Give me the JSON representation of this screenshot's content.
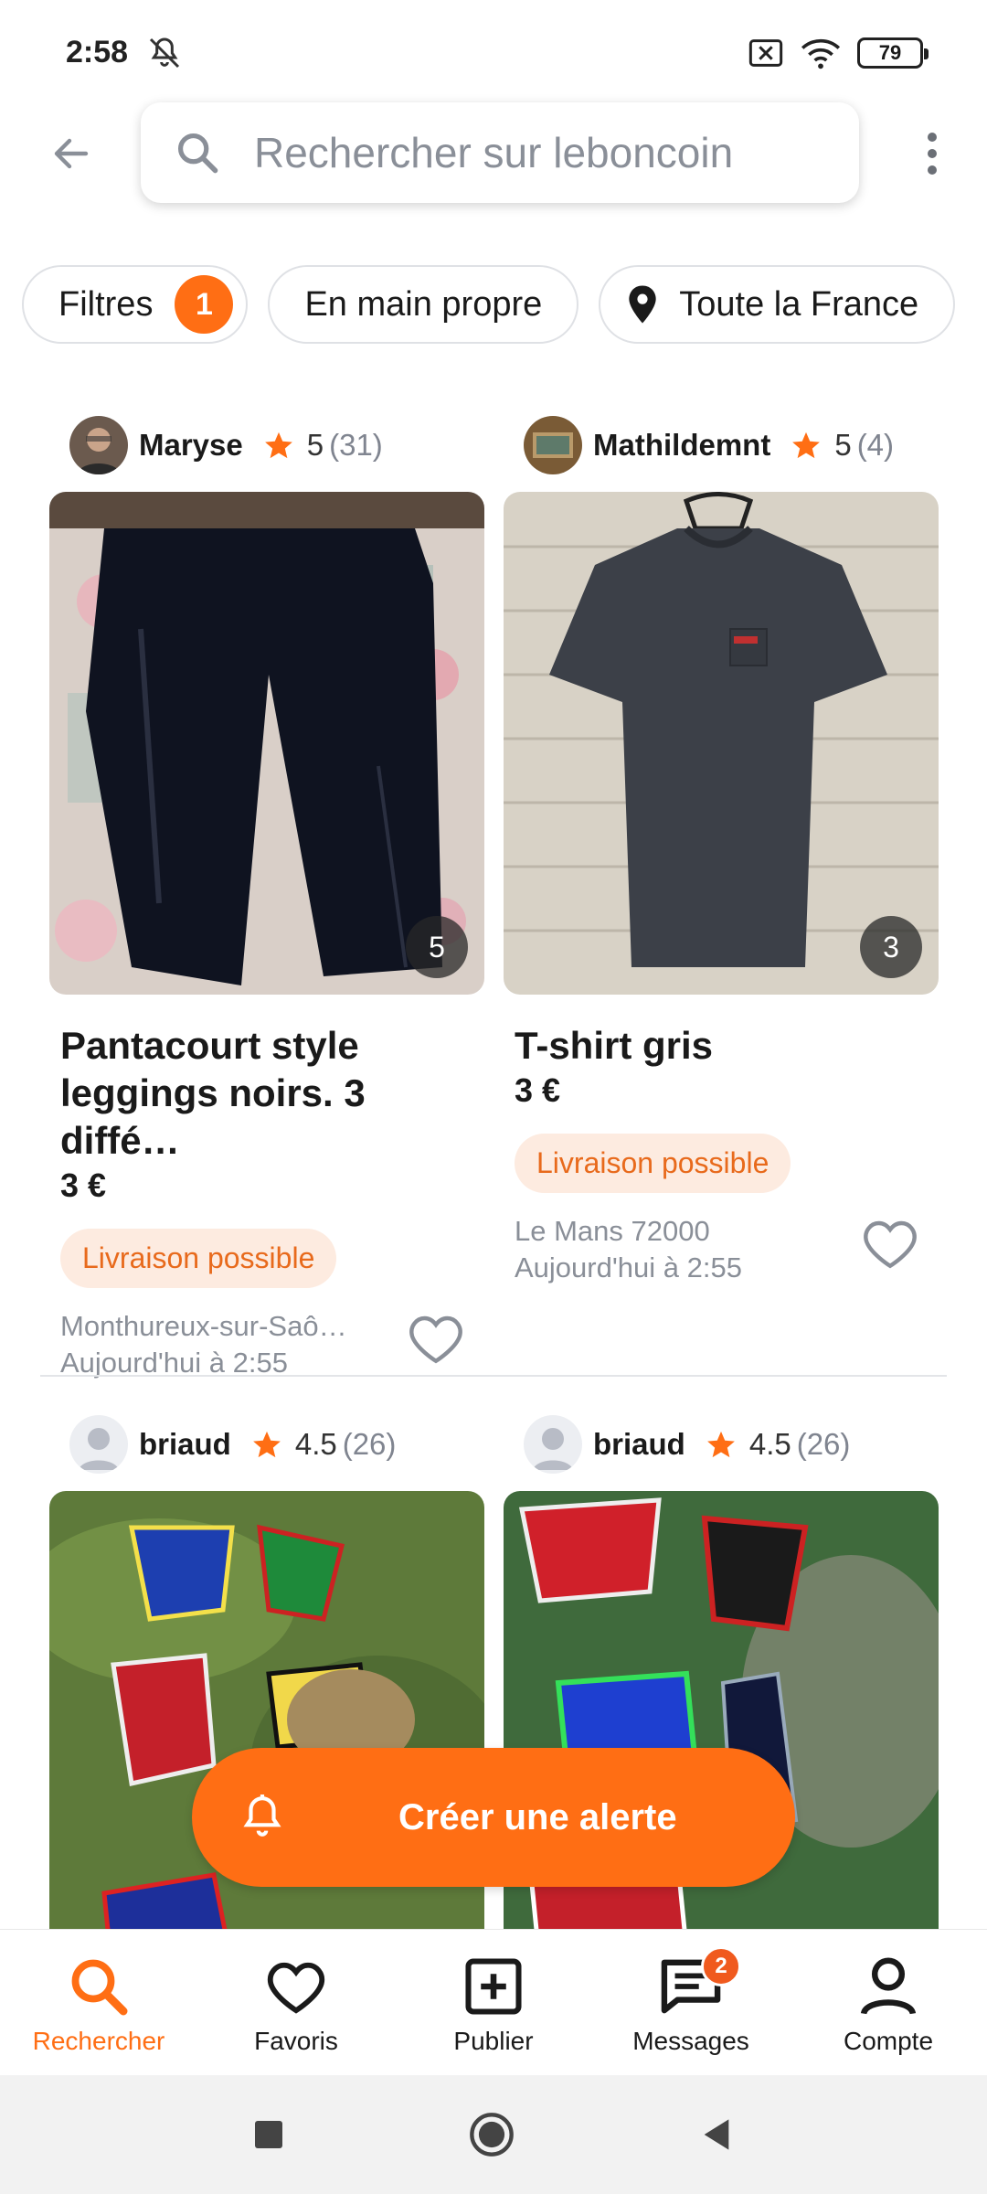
{
  "status_bar": {
    "time": "2:58",
    "battery": "79"
  },
  "search": {
    "placeholder": "Rechercher sur leboncoin"
  },
  "chips": {
    "filters_label": "Filtres",
    "filters_count": "1",
    "delivery_mode_label": "En main propre",
    "location_label": "Toute la France"
  },
  "listings": [
    {
      "seller": "Maryse",
      "rating": "5",
      "reviews": "(31)",
      "photo_count": "5",
      "title": "Pantacourt style leggings noirs. 3 diffé…",
      "price": "3 €",
      "delivery": "Livraison possible",
      "location": "Monthureux-sur-Saô…",
      "date": "Aujourd'hui à 2:55"
    },
    {
      "seller": "Mathildemnt",
      "rating": "5",
      "reviews": "(4)",
      "photo_count": "3",
      "title": "T-shirt gris",
      "price": "3 €",
      "delivery": "Livraison possible",
      "location": "Le Mans 72000",
      "date": "Aujourd'hui à 2:55"
    },
    {
      "seller": "briaud",
      "rating": "4.5",
      "reviews": "(26)"
    },
    {
      "seller": "briaud",
      "rating": "4.5",
      "reviews": "(26)"
    }
  ],
  "alert_button": {
    "label": "Créer une alerte"
  },
  "bottom_nav": {
    "items": [
      {
        "label": "Rechercher",
        "icon": "search-icon",
        "active": true
      },
      {
        "label": "Favoris",
        "icon": "heart-icon"
      },
      {
        "label": "Publier",
        "icon": "plus-square-icon"
      },
      {
        "label": "Messages",
        "icon": "message-icon",
        "badge": "2"
      },
      {
        "label": "Compte",
        "icon": "person-icon"
      }
    ]
  },
  "colors": {
    "accent": "#ff6e14",
    "delivery_bg": "#fdebe0"
  }
}
